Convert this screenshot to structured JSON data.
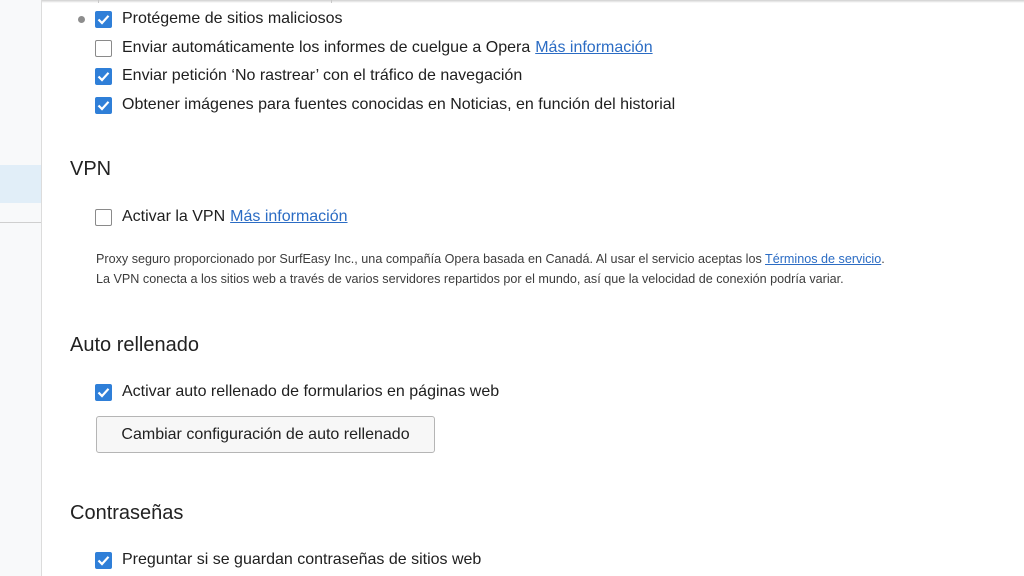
{
  "privacy": {
    "items": [
      {
        "label": "Protégeme de sitios maliciosos",
        "checked": true
      },
      {
        "label": "Enviar automáticamente los informes de cuelgue a Opera",
        "checked": false,
        "link": "Más información"
      },
      {
        "label": "Enviar petición ‘No rastrear’ con el tráfico de navegación",
        "checked": true
      },
      {
        "label": "Obtener imágenes para fuentes conocidas en Noticias, en función del historial",
        "checked": true
      }
    ]
  },
  "vpn": {
    "heading": "VPN",
    "enable_label": "Activar la VPN",
    "enable_checked": false,
    "enable_link": "Más información",
    "desc_line1": "Proxy seguro proporcionado por SurfEasy Inc., una compañía Opera basada en Canadá. Al usar el servicio aceptas los ",
    "terms_link": "Términos de servicio",
    "desc_line1_end": ".",
    "desc_line2": "La VPN conecta a los sitios web a través de varios servidores repartidos por el mundo, así que la velocidad de conexión podría variar."
  },
  "autofill": {
    "heading": "Auto rellenado",
    "enable_label": "Activar auto rellenado de formularios en páginas web",
    "enable_checked": true,
    "button_label": "Cambiar configuración de auto rellenado"
  },
  "passwords": {
    "heading": "Contraseñas",
    "ask_label": "Preguntar si se guardan contraseñas de sitios web",
    "ask_checked": true
  },
  "icons": {
    "checkbox_checked": "checkmark-icon",
    "checkbox_unchecked": "empty-checkbox-icon"
  },
  "colors": {
    "accent": "#2f7fd8",
    "link": "#2b6cc4",
    "sidebar_active": "#e1eef8"
  }
}
